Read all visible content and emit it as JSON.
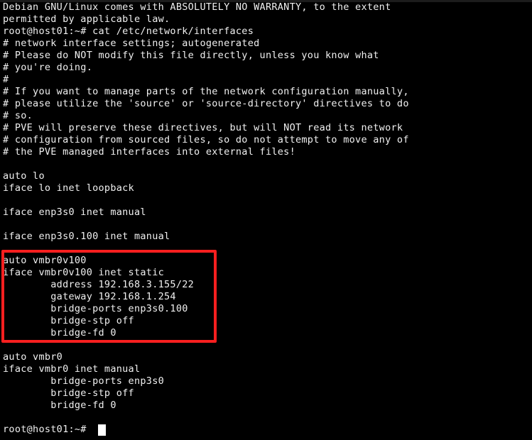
{
  "window": {
    "type": "terminal",
    "background_color": "#000000",
    "foreground_color": "#f0f0f0",
    "top_strip_color": "#1c1c1c"
  },
  "terminal": {
    "lines": [
      "Debian GNU/Linux comes with ABSOLUTELY NO WARRANTY, to the extent",
      "permitted by applicable law.",
      "root@host01:~# cat /etc/network/interfaces",
      "# network interface settings; autogenerated",
      "# Please do NOT modify this file directly, unless you know what",
      "# you're doing.",
      "#",
      "# If you want to manage parts of the network configuration manually,",
      "# please utilize the 'source' or 'source-directory' directives to do",
      "# so.",
      "# PVE will preserve these directives, but will NOT read its network",
      "# configuration from sourced files, so do not attempt to move any of",
      "# the PVE managed interfaces into external files!",
      "",
      "auto lo",
      "iface lo inet loopback",
      "",
      "iface enp3s0 inet manual",
      "",
      "iface enp3s0.100 inet manual",
      "",
      "auto vmbr0v100",
      "iface vmbr0v100 inet static",
      "        address 192.168.3.155/22",
      "        gateway 192.168.1.254",
      "        bridge-ports enp3s0.100",
      "        bridge-stp off",
      "        bridge-fd 0",
      "",
      "auto vmbr0",
      "iface vmbr0 inet manual",
      "        bridge-ports enp3s0",
      "        bridge-stp off",
      "        bridge-fd 0",
      ""
    ],
    "prompt": "root@host01:~# ",
    "cursor": "block"
  },
  "annotation": {
    "highlight_color": "#f91f1f",
    "highlighted_block": [
      "auto vmbr0v100",
      "iface vmbr0v100 inet static",
      "        address 192.168.3.155/22",
      "        gateway 192.168.1.254",
      "        bridge-ports enp3s0.100",
      "        bridge-stp off",
      "        bridge-fd 0"
    ]
  }
}
